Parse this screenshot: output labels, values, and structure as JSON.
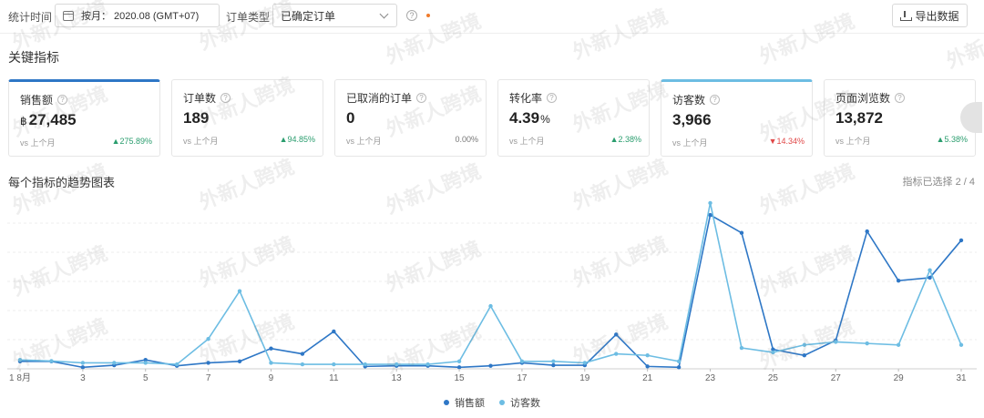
{
  "filters": {
    "stat_time_label": "统计时间",
    "date_value": "按月： 2020.08 (GMT+07)",
    "order_type_label": "订单类型",
    "order_type_value": "已确定订单",
    "export_label": "导出数据"
  },
  "key_metrics": {
    "title": "关键指标",
    "cards": [
      {
        "label": "销售额",
        "currency": "฿",
        "value": "27,485",
        "suffix": "",
        "vs": "vs 上个月",
        "change": "▲275.89%",
        "trend": "up",
        "selected": true
      },
      {
        "label": "订单数",
        "currency": "",
        "value": "189",
        "suffix": "",
        "vs": "vs 上个月",
        "change": "▲94.85%",
        "trend": "up",
        "selected": false
      },
      {
        "label": "已取消的订单",
        "currency": "",
        "value": "0",
        "suffix": "",
        "vs": "vs 上个月",
        "change": "0.00%",
        "trend": "flat",
        "selected": false
      },
      {
        "label": "转化率",
        "currency": "",
        "value": "4.39",
        "suffix": "%",
        "vs": "vs 上个月",
        "change": "▲2.38%",
        "trend": "up",
        "selected": false
      },
      {
        "label": "访客数",
        "currency": "",
        "value": "3,966",
        "suffix": "",
        "vs": "vs 上个月",
        "change": "▼14.34%",
        "trend": "down",
        "selected": true
      },
      {
        "label": "页面浏览数",
        "currency": "",
        "value": "13,872",
        "suffix": "",
        "vs": "vs 上个月",
        "change": "▲5.38%",
        "trend": "up",
        "selected": false
      }
    ]
  },
  "trend": {
    "title": "每个指标的趋势图表",
    "selected_count": "指标已选择 2 / 4"
  },
  "watermark": "外新人跨境",
  "colors": {
    "series1": "#2e77c6",
    "series2": "#6dbde3",
    "up": "#2a9d6e",
    "down": "#e04848"
  },
  "chart_data": {
    "type": "line",
    "x": [
      1,
      2,
      3,
      4,
      5,
      6,
      7,
      8,
      9,
      10,
      11,
      12,
      13,
      14,
      15,
      16,
      17,
      18,
      19,
      20,
      21,
      22,
      23,
      24,
      25,
      26,
      27,
      28,
      29,
      30,
      31
    ],
    "tick_labels": [
      "1 8月",
      "3",
      "5",
      "7",
      "9",
      "11",
      "13",
      "15",
      "17",
      "19",
      "21",
      "23",
      "25",
      "27",
      "29",
      "31"
    ],
    "series": [
      {
        "name": "销售额",
        "values": [
          2.5,
          2.5,
          0.5,
          1.2,
          3.0,
          1.0,
          2.0,
          2.5,
          6.8,
          5.0,
          12.5,
          0.8,
          1.0,
          1.0,
          0.5,
          1.0,
          2.0,
          1.2,
          1.2,
          11.5,
          0.8,
          0.5,
          51.5,
          45.5,
          6.5,
          4.5,
          9.5,
          46.0,
          29.5,
          30.5,
          43.0
        ]
      },
      {
        "name": "访客数",
        "values": [
          3.0,
          2.6,
          2.0,
          2.0,
          2.0,
          1.5,
          10.0,
          26.0,
          2.0,
          1.5,
          1.5,
          1.5,
          1.5,
          1.5,
          2.5,
          21.0,
          2.5,
          2.5,
          2.0,
          5.0,
          4.5,
          2.5,
          55.5,
          7.0,
          5.5,
          8.0,
          9.0,
          8.5,
          8.0,
          33.0,
          8.0
        ]
      }
    ]
  }
}
